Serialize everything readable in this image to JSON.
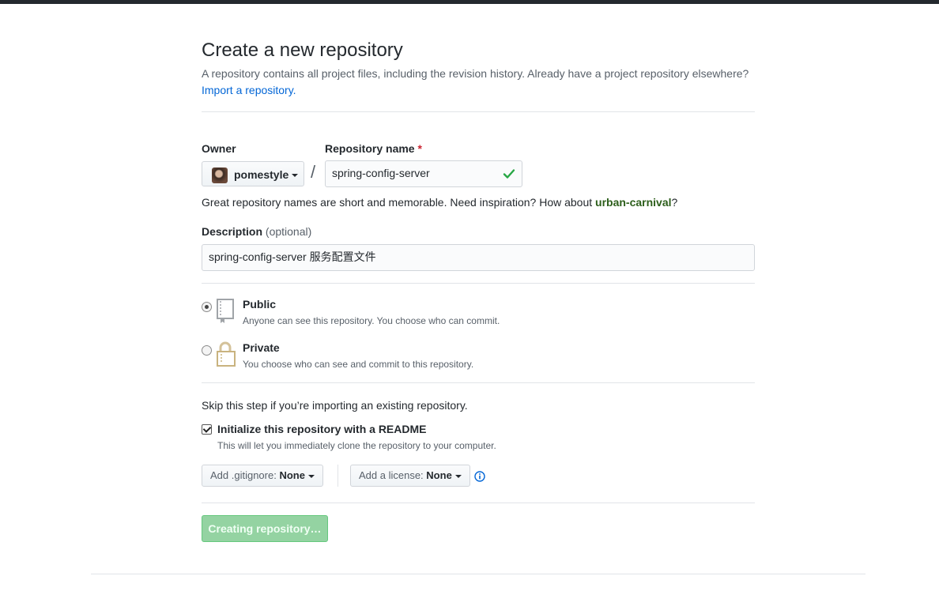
{
  "page": {
    "title": "Create a new repository",
    "subhead": "A repository contains all project files, including the revision history. Already have a project repository elsewhere?",
    "import_link": "Import a repository."
  },
  "owner": {
    "label": "Owner",
    "name": "pomestyle"
  },
  "repo_name": {
    "label": "Repository name",
    "required_mark": "*",
    "value": "spring-config-server",
    "valid": true
  },
  "hint": {
    "prefix": "Great repository names are short and memorable. Need inspiration? How about ",
    "suggestion": "urban-carnival",
    "suffix": "?"
  },
  "description": {
    "label": "Description",
    "optional": "(optional)",
    "value": "spring-config-server 服务配置文件"
  },
  "visibility": {
    "selected": "public",
    "public": {
      "title": "Public",
      "desc": "Anyone can see this repository. You choose who can commit."
    },
    "private": {
      "title": "Private",
      "desc": "You choose who can see and commit to this repository."
    }
  },
  "init": {
    "skip_text": "Skip this step if you’re importing an existing repository.",
    "readme_label": "Initialize this repository with a README",
    "readme_checked": true,
    "readme_desc": "This will let you immediately clone the repository to your computer."
  },
  "gitignore": {
    "label": "Add .gitignore:",
    "value": "None"
  },
  "license": {
    "label": "Add a license:",
    "value": "None"
  },
  "submit": {
    "label": "Creating repository…"
  },
  "colors": {
    "link": "#0366d6",
    "success": "#28a745",
    "submit_bg": "#94d3a2"
  }
}
